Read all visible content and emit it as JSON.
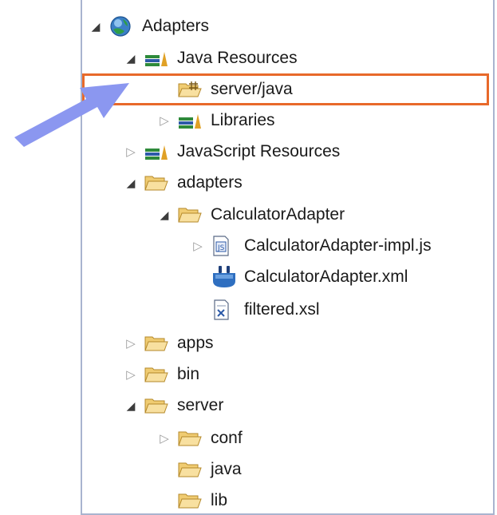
{
  "tree": {
    "items": [
      {
        "label": "Adapters",
        "icon": "globe-project-icon",
        "state": "expanded"
      },
      {
        "label": "Java Resources",
        "icon": "books-icon",
        "state": "expanded"
      },
      {
        "label": "server/java",
        "icon": "package-folder-icon",
        "state": "leaf",
        "selected": true
      },
      {
        "label": "Libraries",
        "icon": "books-icon",
        "state": "collapsed"
      },
      {
        "label": "JavaScript Resources",
        "icon": "books-icon",
        "state": "collapsed"
      },
      {
        "label": "adapters",
        "icon": "folder-icon",
        "state": "expanded"
      },
      {
        "label": "CalculatorAdapter",
        "icon": "folder-icon",
        "state": "expanded"
      },
      {
        "label": "CalculatorAdapter-impl.js",
        "icon": "js-file-icon",
        "state": "collapsed"
      },
      {
        "label": "CalculatorAdapter.xml",
        "icon": "adapter-plug-icon",
        "state": "leaf"
      },
      {
        "label": "filtered.xsl",
        "icon": "xsl-file-icon",
        "state": "leaf"
      },
      {
        "label": "apps",
        "icon": "folder-icon",
        "state": "collapsed"
      },
      {
        "label": "bin",
        "icon": "folder-icon",
        "state": "collapsed"
      },
      {
        "label": "server",
        "icon": "folder-icon",
        "state": "expanded"
      },
      {
        "label": "conf",
        "icon": "folder-icon",
        "state": "collapsed"
      },
      {
        "label": "java",
        "icon": "folder-icon",
        "state": "leaf"
      },
      {
        "label": "lib",
        "icon": "folder-icon",
        "state": "leaf"
      }
    ]
  },
  "colors": {
    "highlight_border": "#e8692a",
    "arrow": "#8b97f0",
    "panel_border": "#a9b4cf"
  }
}
